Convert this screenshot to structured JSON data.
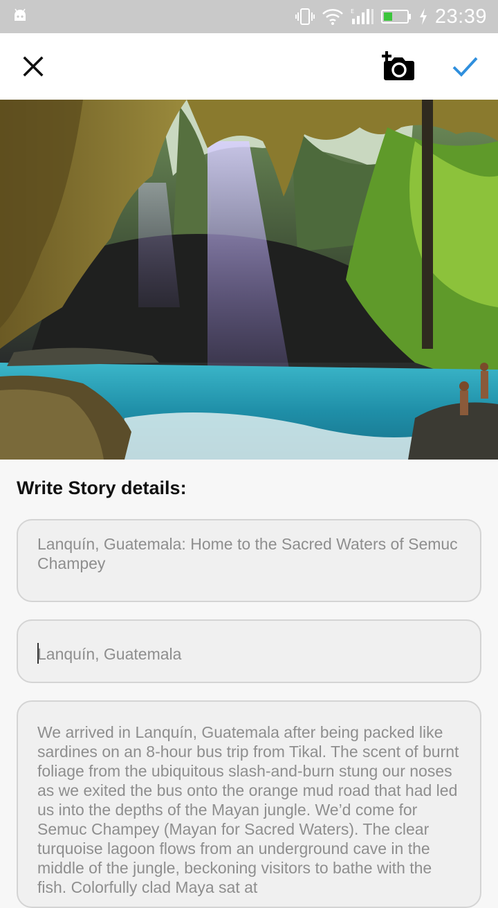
{
  "status_bar": {
    "time": "23:39",
    "icons": [
      "android-icon",
      "vibrate-icon",
      "wifi-icon",
      "signal-icon",
      "battery-icon",
      "charging-icon"
    ]
  },
  "toolbar": {
    "close_icon": "close-icon",
    "add_photo_icon": "add-photo-camera-icon",
    "confirm_icon": "checkmark-icon",
    "accent_color": "#2f8fdd"
  },
  "hero_image": {
    "description_icon": "cave-lagoon-photo"
  },
  "form": {
    "heading": "Write Story details:",
    "title_value": "Lanquín, Guatemala: Home to the Sacred Waters of Semuc Champey",
    "location_value": "Lanquín, Guatemala",
    "story_value": "We arrived in Lanquín, Guatemala after being packed like sardines on an 8-hour bus trip from Tikal. The scent of burnt foliage from the ubiquitous slash-and-burn stung our noses as we exited the bus onto the orange mud road that had led us into the depths of the Mayan jungle. We’d come for Semuc Champey (Mayan for Sacred Waters). The clear turquoise lagoon flows from an underground cave in the middle of the jungle, beckoning visitors to bathe with the fish. Colorfully clad Maya sat at"
  }
}
